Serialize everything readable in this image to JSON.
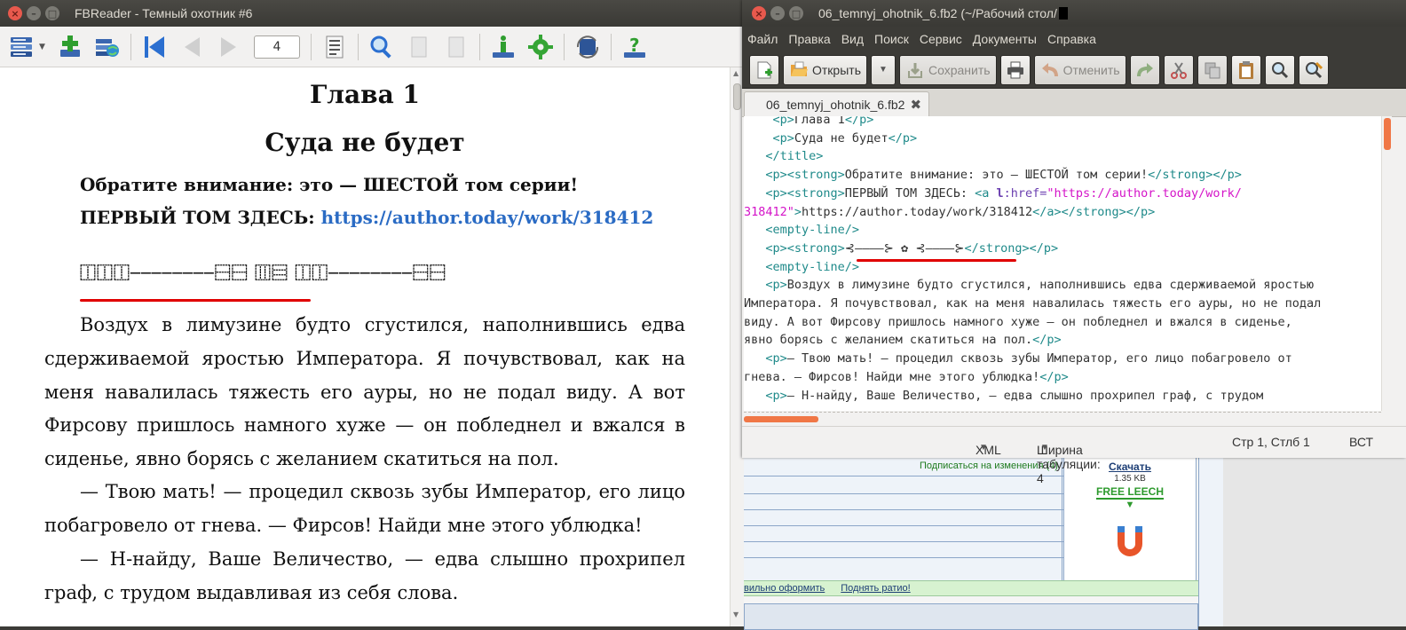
{
  "fbreader": {
    "title": "FBReader - Темный охотник #6",
    "page_number": "4",
    "content": {
      "chapter": "Глава 1",
      "subtitle": "Суда не будет",
      "note_line1": "Обратите внимание: это — ШЕСТОЙ том серии!",
      "note_line2_prefix": "ПЕРВЫЙ ТОМ ЗДЕСЬ: ",
      "note_link": "https://author.today/work/318412",
      "glyph_line": "⿰⿰⿰────────⿱⿱ ⿲⿳ ⿰⿰────────⿱⿱",
      "para1": "Воздух в лимузине будто сгустился, наполнившись едва сдерживаемой яростью Императора. Я почувствовал, как на меня навалилась тяжесть его ауры, но не подал виду. А вот Фирсову пришлось намного хуже — он побледнел и вжался в сиденье, явно борясь с желанием скатиться на пол.",
      "para2": "— Твою мать! — процедил сквозь зубы Император, его лицо побагровело от гнева. — Фирсов! Найди мне этого ублюдка!",
      "para3": "— Н-найду, Ваше Величество, — едва слышно прохрипел граф, с трудом выдавливая из себя слова."
    }
  },
  "gedit": {
    "title": "06_temnyj_ohotnik_6.fb2 (~/Рабочий стол/",
    "menu": [
      "Файл",
      "Правка",
      "Вид",
      "Поиск",
      "Сервис",
      "Документы",
      "Справка"
    ],
    "toolbar": {
      "open": "Открыть",
      "save": "Сохранить",
      "undo": "Отменить"
    },
    "tab_label": "06_temnyj_ohotnik_6.fb2",
    "status": {
      "language": "XML",
      "tab_width": "Ширина табуляции:  4",
      "position": "Стр 1, Стлб 1",
      "mode": "ВСТ"
    },
    "code": {
      "l1_text": "Глава 1",
      "l2_text": "Суда не будет",
      "l4_text": "Обратите внимание: это — ШЕСТОЙ том серии!",
      "l5_text": "ПЕРВЫЙ ТОМ ЗДЕСЬ: ",
      "l5_href": "\"https://author.today/work/",
      "l6_href": "318412\"",
      "l6_text": "https://author.today/work/318412",
      "l8_glyphs": "⊰————⊱ ✿ ⊰————⊱",
      "p1_l1": "Воздух в лимузине будто сгустился, наполнившись едва сдерживаемой яростью",
      "p1_l2": "Императора. Я почувствовал, как на меня навалилась тяжесть его ауры, но не подал",
      "p1_l3": "виду. А вот Фирсову пришлось намного хуже — он побледнел и вжался в сиденье,",
      "p1_l4": "явно борясь с желанием скатиться на пол.",
      "p2_l1": "— Твою мать! — процедил сквозь зубы Император, его лицо побагровело от",
      "p2_l2": "гнева. — Фирсов! Найди мне этого ублюдка!",
      "p3_l1": "— Н-найду, Ваше Величество, — едва слышно прохрипел граф, с трудом"
    }
  },
  "browser_bg": {
    "subscribe": "Подписаться на изменения (4)",
    "download": "Скачать",
    "size": "1.35 KB",
    "free_leech": "FREE LEECH",
    "link1": "вильно оформить",
    "link2": "Поднять ратио!"
  },
  "colors": {
    "accent_orange": "#f07746",
    "link_blue": "#2a6bc4",
    "tag_teal": "#1f8a8a",
    "string_magenta": "#d414c8",
    "highlight_red": "#e00000"
  }
}
